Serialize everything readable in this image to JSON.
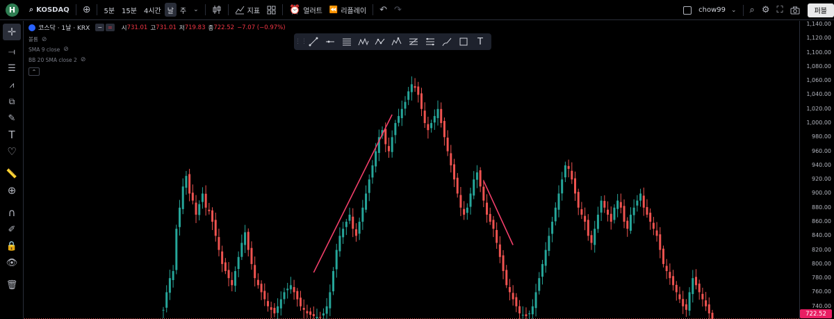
{
  "topbar": {
    "avatar_letter": "H",
    "symbol": "KOSDAQ",
    "intervals": [
      "5분",
      "15분",
      "4시간",
      "날",
      "주"
    ],
    "active_interval": "날",
    "indicators_label": "지표",
    "alerts_label": "얼러트",
    "replay_label": "리플레이",
    "layout_name": "chow99",
    "publish_label": "퍼블"
  },
  "legend": {
    "symbol_title": "코스닥 · 1날 · KRX",
    "open_label": "시",
    "open_value": "731.01",
    "high_label": "고",
    "high_value": "731.01",
    "low_label": "저",
    "low_value": "719.83",
    "close_label": "종",
    "close_value": "722.52",
    "change": "−7.07 (−0.97%)",
    "indicators": [
      "볼륨",
      "SMA 9 close",
      "BB 20 SMA close 2"
    ]
  },
  "price_axis": {
    "ticks": [
      "1,140.00",
      "1,120.00",
      "1,100.00",
      "1,080.00",
      "1,060.00",
      "1,040.00",
      "1,020.00",
      "1,000.00",
      "980.00",
      "960.00",
      "940.00",
      "920.00",
      "900.00",
      "880.00",
      "860.00",
      "840.00",
      "820.00",
      "800.00",
      "780.00",
      "760.00",
      "740.00"
    ],
    "last_price": "722.52"
  },
  "colors": {
    "up": "#26a69a",
    "down": "#ef5350",
    "trendline": "#f23f6a",
    "last_price_bg": "#e91e63"
  },
  "chart_data": {
    "type": "candlestick",
    "ylim": [
      722,
      1145
    ],
    "trendlines": [
      {
        "from": 788,
        "to": 1012
      },
      {
        "from": 918,
        "to": 827
      }
    ],
    "closes": [
      735,
      760,
      780,
      790,
      850,
      880,
      910,
      925,
      900,
      890,
      870,
      885,
      900,
      880,
      875,
      860,
      840,
      820,
      800,
      790,
      780,
      770,
      790,
      810,
      830,
      845,
      820,
      800,
      780,
      770,
      760,
      750,
      740,
      735,
      730,
      740,
      750,
      760,
      765,
      770,
      760,
      750,
      740,
      735,
      730,
      728,
      726,
      725,
      724,
      730,
      740,
      760,
      790,
      820,
      840,
      850,
      860,
      870,
      850,
      840,
      860,
      880,
      900,
      920,
      940,
      960,
      980,
      990,
      970,
      960,
      980,
      1000,
      1010,
      1020,
      1030,
      1045,
      1055,
      1050,
      1040,
      1020,
      1000,
      990,
      1000,
      1010,
      1020,
      1000,
      980,
      960,
      940,
      920,
      900,
      880,
      870,
      880,
      900,
      920,
      930,
      910,
      890,
      870,
      860,
      850,
      830,
      810,
      790,
      770,
      760,
      750,
      740,
      730,
      728,
      726,
      730,
      740,
      760,
      780,
      800,
      820,
      840,
      860,
      880,
      900,
      920,
      940,
      935,
      920,
      900,
      880,
      870,
      860,
      840,
      830,
      850,
      870,
      890,
      880,
      870,
      860,
      880,
      890,
      880,
      860,
      850,
      870,
      880,
      890,
      900,
      880,
      870,
      860,
      850,
      840,
      820,
      800,
      790,
      780,
      770,
      760,
      750,
      740,
      735,
      760,
      780,
      770,
      760,
      750,
      740,
      730,
      722
    ]
  }
}
